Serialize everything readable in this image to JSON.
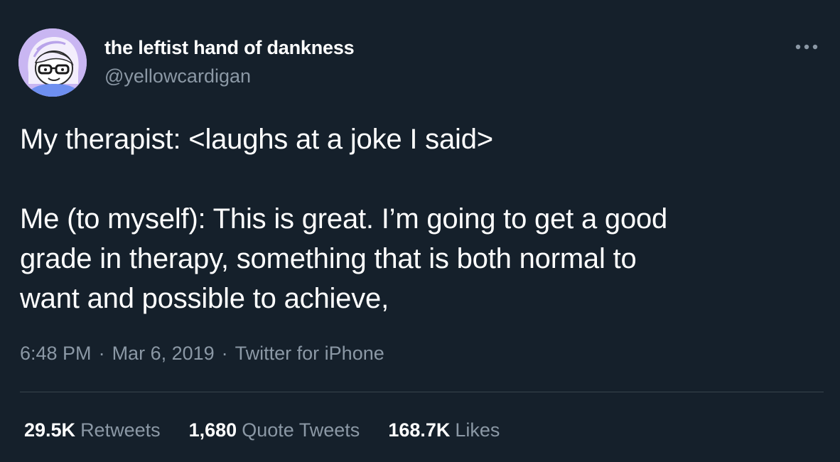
{
  "author": {
    "display_name": "the leftist hand of dankness",
    "handle": "@yellowcardigan",
    "avatar_icon": "cartoon-woman-with-glasses-avatar"
  },
  "tweet": {
    "paragraphs": [
      "My therapist: <laughs at a joke I said>",
      "Me (to myself): This is great. I’m going to get a good\ngrade in therapy, something that is both normal to\nwant and possible to achieve,"
    ]
  },
  "meta": {
    "time": "6:48 PM",
    "separator": "·",
    "date": "Mar 6, 2019",
    "source": "Twitter for iPhone"
  },
  "stats": {
    "retweets_count": "29.5K",
    "retweets_label": "Retweets",
    "quotes_count": "1,680",
    "quotes_label": "Quote Tweets",
    "likes_count": "168.7K",
    "likes_label": "Likes"
  },
  "menu_icon": "more-dots-icon",
  "colors": {
    "background": "#15202b",
    "text": "#ffffff",
    "secondary_text": "#8b98a5",
    "divider": "#38444d"
  }
}
